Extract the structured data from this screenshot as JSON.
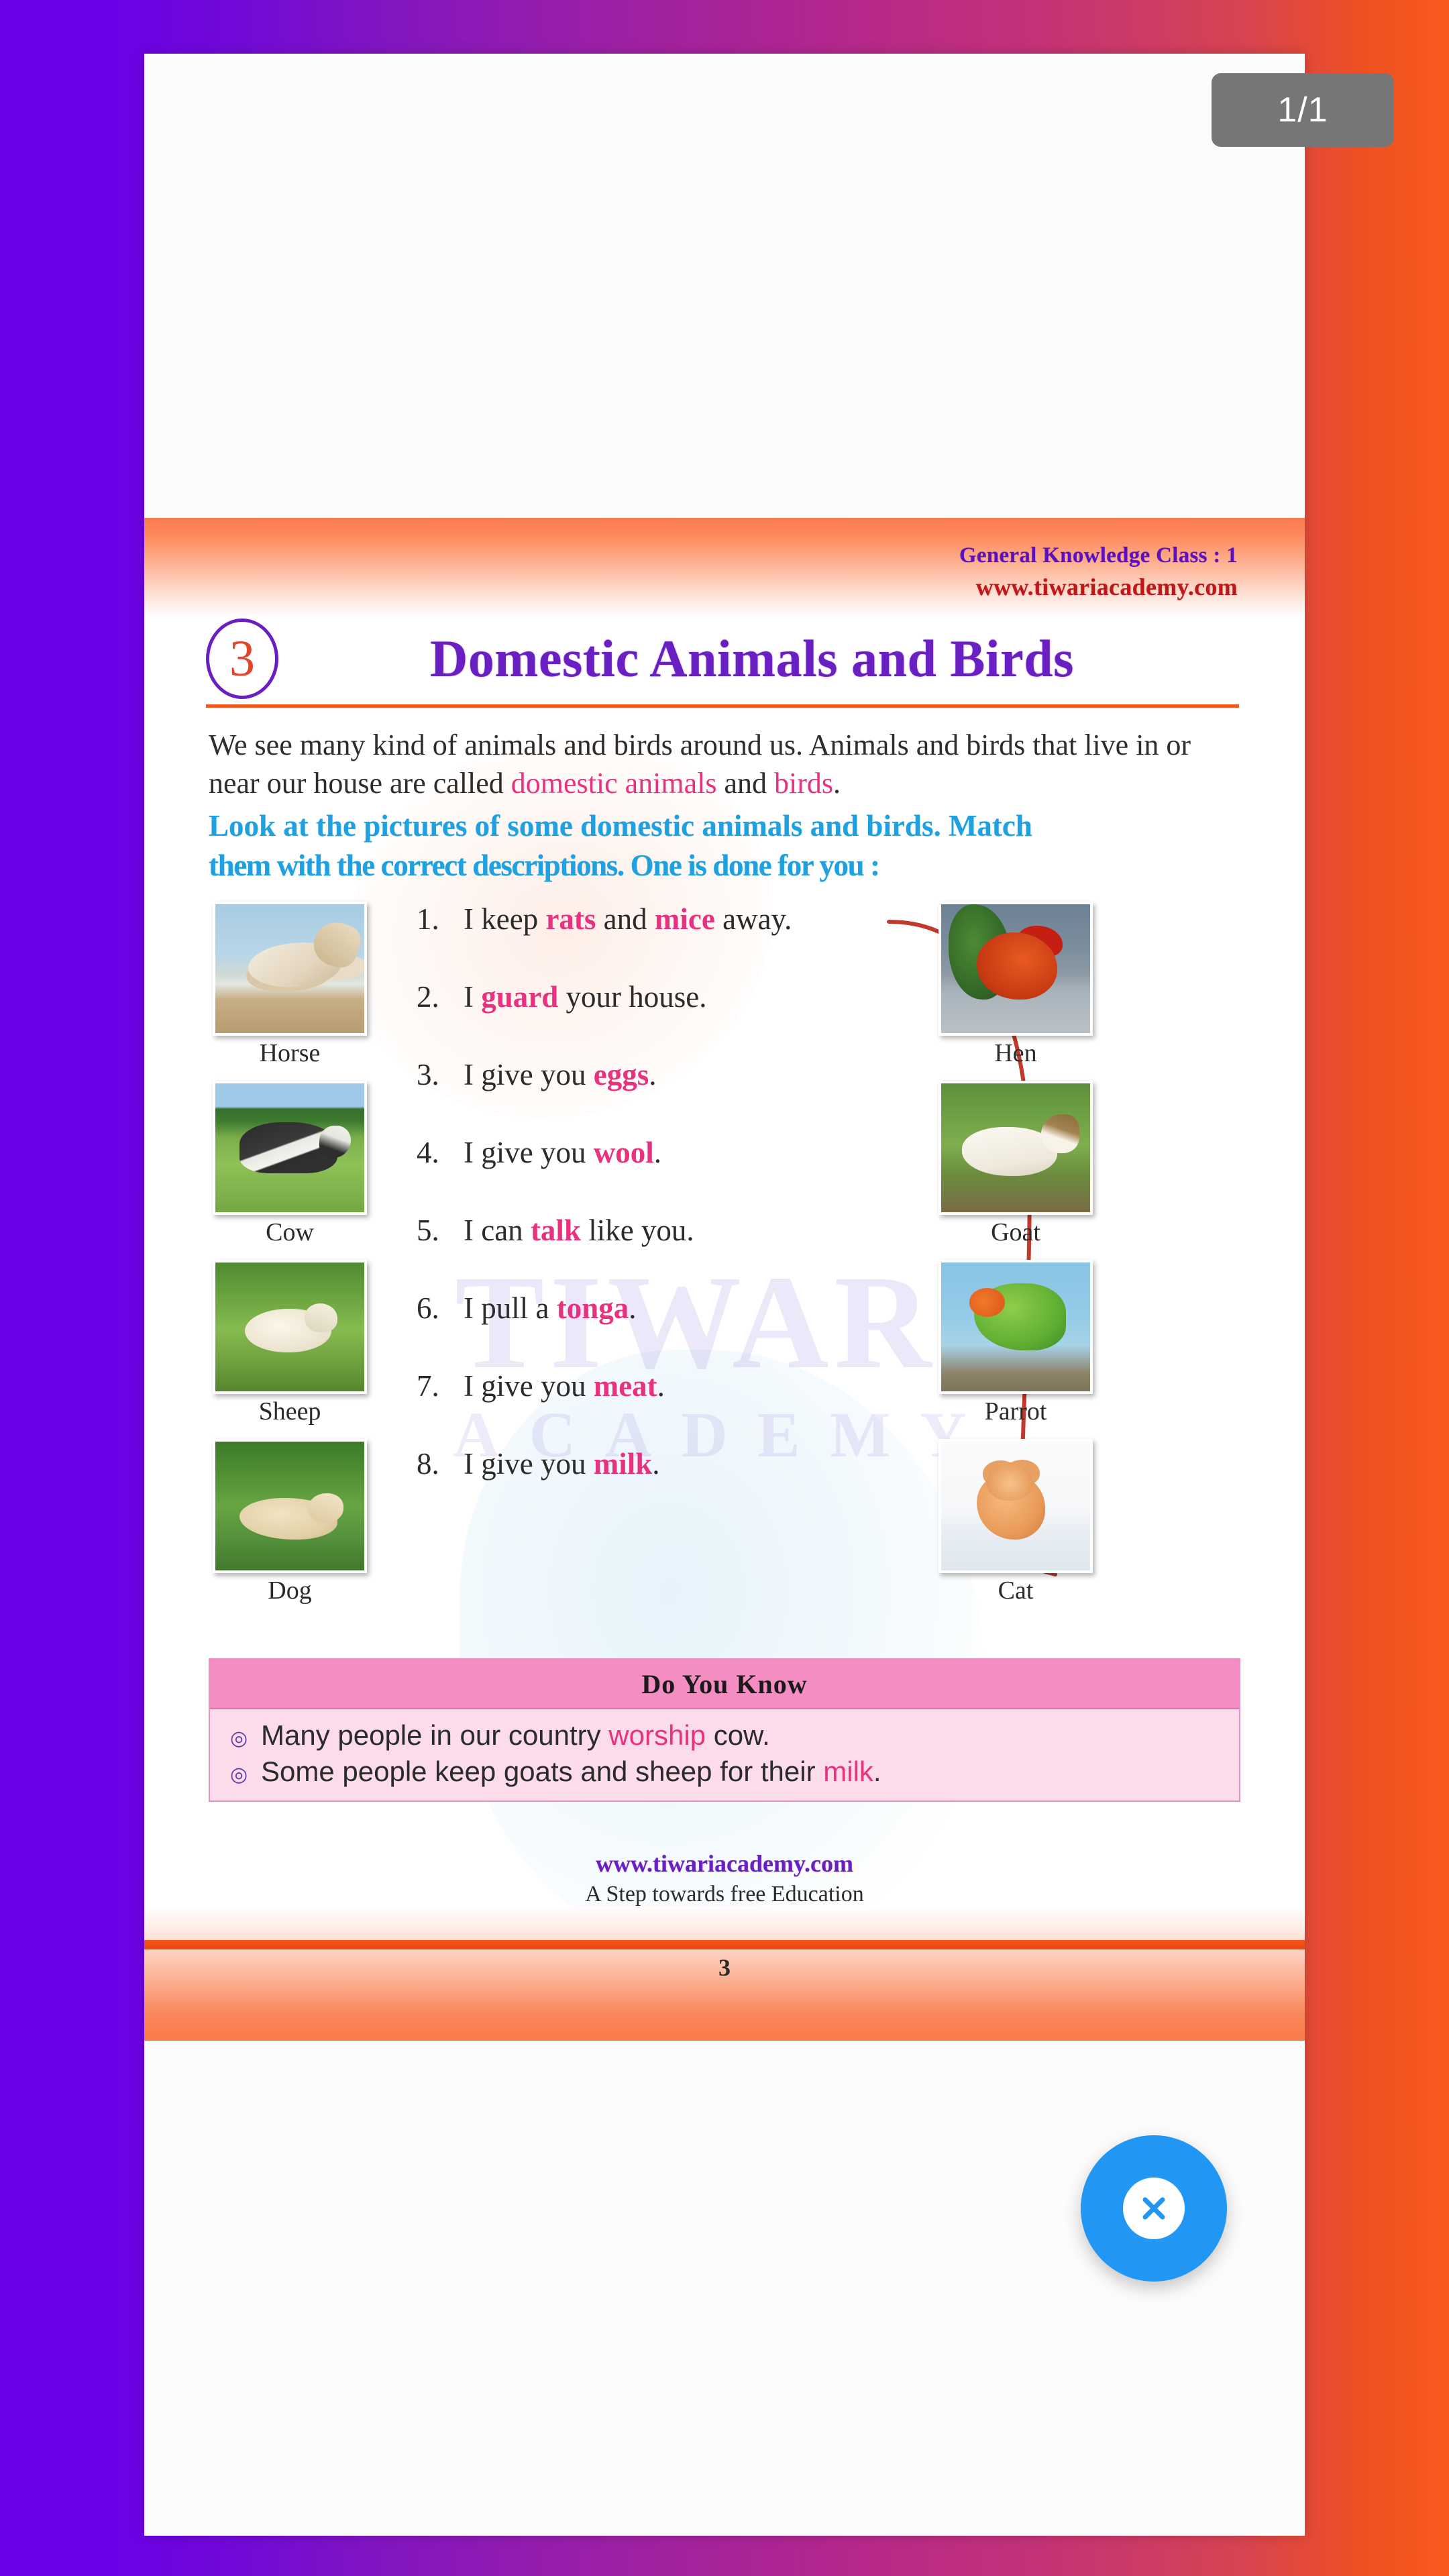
{
  "viewer": {
    "page_indicator": "1/1",
    "close_button_label": "close-fab",
    "close_icon": "close-x-icon"
  },
  "document": {
    "header": {
      "class_line": "General Knowledge Class : 1",
      "site_url": "www.tiwariacademy.com"
    },
    "chapter_number": "3",
    "title": "Domestic Animals and Birds",
    "intro": {
      "part1": "We see many kind of animals and birds around us. Animals and birds that live in or near our house are called ",
      "highlight1": "domestic animals",
      "part2": " and ",
      "highlight2": "birds",
      "part3": "."
    },
    "instruction_line1": "Look at the pictures of some domestic animals and birds. Match",
    "instruction_line2": "them with the correct descriptions. One is done for you :",
    "left_pictures": [
      {
        "label": "Horse",
        "image": "horse-photo"
      },
      {
        "label": "Cow",
        "image": "cow-photo"
      },
      {
        "label": "Sheep",
        "image": "sheep-photo"
      },
      {
        "label": "Dog",
        "image": "dog-photo"
      }
    ],
    "right_pictures": [
      {
        "label": "Hen",
        "image": "hen-photo"
      },
      {
        "label": "Goat",
        "image": "goat-photo"
      },
      {
        "label": "Parrot",
        "image": "parrot-photo"
      },
      {
        "label": "Cat",
        "image": "cat-photo"
      }
    ],
    "questions": [
      {
        "num": "1.",
        "pre": "I keep ",
        "hl": "rats",
        "mid": " and ",
        "hl2": "mice",
        "post": " away."
      },
      {
        "num": "2.",
        "pre": "I ",
        "hl": "guard",
        "mid": " your house.",
        "hl2": "",
        "post": ""
      },
      {
        "num": "3.",
        "pre": "I give you ",
        "hl": "eggs",
        "mid": ".",
        "hl2": "",
        "post": ""
      },
      {
        "num": "4.",
        "pre": "I give you ",
        "hl": "wool",
        "mid": ".",
        "hl2": "",
        "post": ""
      },
      {
        "num": "5.",
        "pre": "I can ",
        "hl": "talk",
        "mid": " like you.",
        "hl2": "",
        "post": ""
      },
      {
        "num": "6.",
        "pre": "I pull a ",
        "hl": "tonga",
        "mid": ".",
        "hl2": "",
        "post": ""
      },
      {
        "num": "7.",
        "pre": "I give you ",
        "hl": "meat",
        "mid": ".",
        "hl2": "",
        "post": ""
      },
      {
        "num": "8.",
        "pre": "I give you ",
        "hl": "milk",
        "mid": ".",
        "hl2": "",
        "post": ""
      }
    ],
    "do_you_know": {
      "heading": "Do You Know",
      "items": [
        {
          "pre": "Many people in our country ",
          "hl": "worship",
          "post": " cow."
        },
        {
          "pre": "Some people keep goats and sheep for their ",
          "hl": "milk",
          "post": "."
        }
      ]
    },
    "footer": {
      "url": "www.tiwariacademy.com",
      "tagline": "A Step towards free Education",
      "page_number": "3"
    },
    "watermark": {
      "line1": "TIWARI",
      "line2": "ACADEMY"
    }
  },
  "colors": {
    "title_purple": "#6a1fc2",
    "accent_orange": "#f4561b",
    "highlight_pink": "#e8317f",
    "instruction_blue": "#1fa0e0",
    "fab_blue": "#2196f3",
    "dyk_header_pink": "#f48ec2",
    "dyk_body_pink": "#fcdceb",
    "badge_grey": "#767676"
  }
}
